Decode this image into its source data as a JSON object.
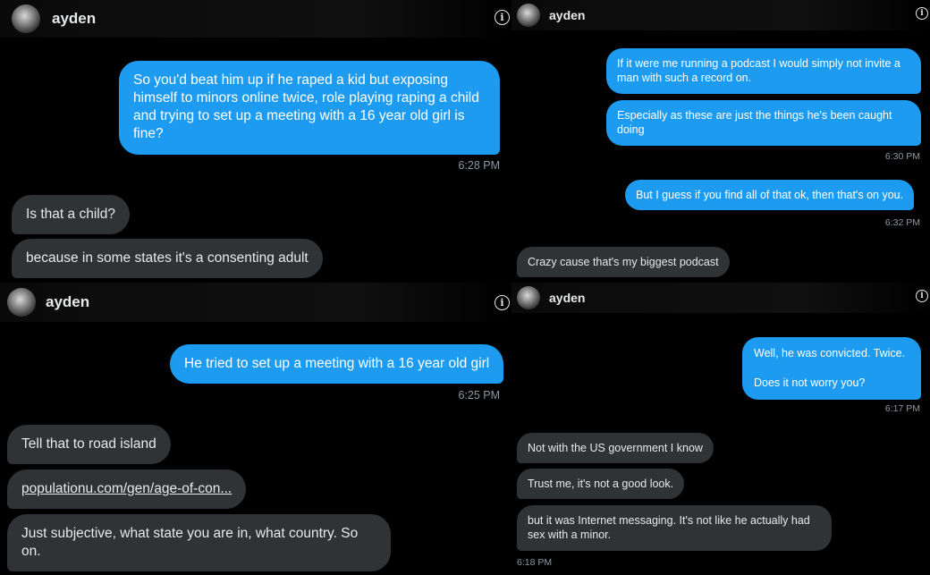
{
  "p1": {
    "username": "ayden",
    "messages": [
      "So you'd beat him up if he raped a kid but exposing himself to minors online twice, role playing raping a child and trying to set up a meeting with a 16 year old girl is fine?",
      "Is that a child?",
      "because in some states it's a consenting adult"
    ],
    "time": "6:28 PM"
  },
  "p2": {
    "username": "ayden",
    "messages": [
      "If it were me running a podcast I would simply not invite a man with such a record on.",
      "Especially as these are just the things he's been caught doing",
      "But I guess if you find all of that ok, then that's on you.",
      "Crazy cause that's my biggest podcast"
    ],
    "times": [
      "6:30 PM",
      "6:32 PM"
    ]
  },
  "p3": {
    "username": "ayden",
    "messages": [
      "He tried to set up a meeting with a 16 year old girl",
      "Tell that to road island",
      "populationu.com/gen/age-of-con...",
      "Just subjective, what state you are in, what country. So on."
    ],
    "time": "6:25 PM"
  },
  "p4": {
    "username": "ayden",
    "messages": [
      "Well, he was convicted. Twice.",
      "Does it not worry you?",
      "Not with the US government I know",
      "Trust me, it's not a good look.",
      "but it was Internet messaging. It's not like he actually had sex with a minor."
    ],
    "times": [
      "6:17 PM",
      "6:18 PM"
    ]
  },
  "icons": {
    "info": "info-icon",
    "avatar": "avatar"
  },
  "colors": {
    "outgoing": "#1d9bf0",
    "incoming": "#2f3336",
    "timestamp": "#8b98a5",
    "background": "#000000"
  }
}
